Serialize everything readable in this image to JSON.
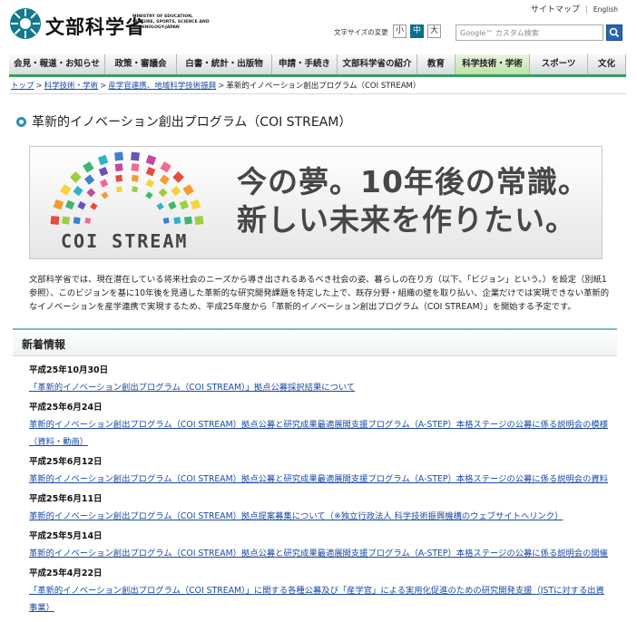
{
  "header": {
    "logo_text": "文部科学省",
    "logo_en": "MINISTRY OF EDUCATION, CULTURE, SPORTS, SCIENCE AND TECHNOLOGY-JAPAN",
    "top_links": [
      "サイトマップ",
      "English"
    ],
    "font_size_label": "文字サイズの変更",
    "font_size_options": [
      "小",
      "中",
      "大"
    ],
    "search_placeholder": "Google™ カスタム検索"
  },
  "nav": {
    "items": [
      "会見・報道・お知らせ",
      "政策・審議会",
      "白書・統計・出版物",
      "申請・手続き",
      "文部科学省の紹介",
      "教育",
      "科学技術・学術",
      "スポーツ",
      "文化"
    ]
  },
  "breadcrumb": [
    "トップ",
    "科学技術・学術",
    "産学官連携、地域科学技術振興",
    "革新的イノベーション創出プログラム（COI STREAM）"
  ],
  "page_title": "革新的イノベーション創出プログラム（COI STREAM）",
  "banner": {
    "logo_text": "COI STREAM",
    "slogan_line1": "今の夢。10年後の常識。",
    "slogan_line2": "新しい未来を作りたい。"
  },
  "intro": "文部科学省では、現在潜在している将来社会のニーズから導き出されるあるべき社会の姿、暮らしの在り方（以下、「ビジョン」という。）を設定（別紙1参照）、このビジョンを基に10年後を見通した革新的な研究開発課題を特定した上で、既存分野・組織の壁を取り払い、企業だけでは実現できない革新的なイノベーションを産学連携で実現するため、平成25年度から「革新的イノベーション創出プログラム（COI STREAM）」を開始する予定です。",
  "news": {
    "title": "新着情報",
    "items": [
      {
        "date": "平成25年10月30日",
        "link": "「革新的イノベーション創出プログラム（COI STREAM）」拠点公募採択結果について"
      },
      {
        "date": "平成25年6月24日",
        "link": "革新的イノベーション創出プログラム（COI STREAM）拠点公募と研究成果最適展開支援プログラム（A-STEP）本格ステージの公募に係る説明会の模様（資料・動画）"
      },
      {
        "date": "平成25年6月12日",
        "link": "革新的イノベーション創出プログラム（COI STREAM）拠点公募と研究成果最適展開支援プログラム（A-STEP）本格ステージの公募に係る説明会の資料"
      },
      {
        "date": "平成25年6月11日",
        "link": "革新的イノベーション創出プログラム（COI STREAM）拠点提案募集について（※独立行政法人 科学技術振興機構のウェブサイトへリンク）"
      },
      {
        "date": "平成25年5月14日",
        "link": "革新的イノベーション創出プログラム（COI STREAM）拠点公募と研究成果最適展開支援プログラム（A-STEP）本格ステージの公募に係る説明会の開催"
      },
      {
        "date": "平成25年4月22日",
        "link": "「革新的イノベーション創出プログラム（COI STREAM）」に関する各種公募及び「産学官」による実用化促進のための研究開発支援（JSTに対する出資事業）"
      }
    ]
  },
  "colors": {
    "nav_bar": "#1d7a86",
    "nav_underline": "#35a05a",
    "link": "#1a4aa6",
    "title_bullet": "#2b8fb5"
  }
}
